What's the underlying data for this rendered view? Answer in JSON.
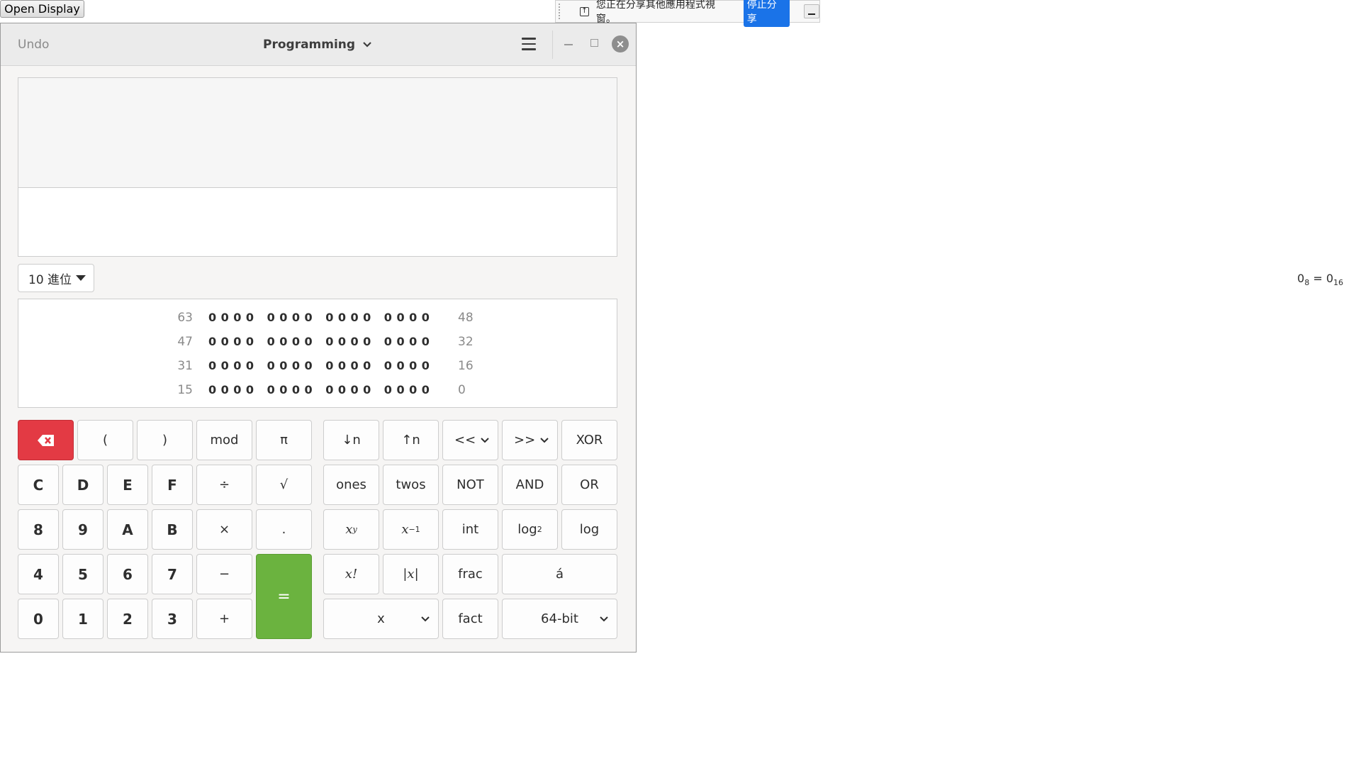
{
  "open_display": "Open Display",
  "share_bar": {
    "message": "您正在分享其他應用程式視窗。",
    "stop_label": "停止分享"
  },
  "header": {
    "undo": "Undo",
    "mode": "Programming"
  },
  "display": {
    "base_selector": "10 進位",
    "conversion_lhs": "0",
    "conversion_lhs_base": "8",
    "conversion_rhs": "0",
    "conversion_rhs_base": "16",
    "eq_sign": "="
  },
  "bits": [
    {
      "hi": "63",
      "value": "0000 0000 0000 0000",
      "lo": "48"
    },
    {
      "hi": "47",
      "value": "0000 0000 0000 0000",
      "lo": "32"
    },
    {
      "hi": "31",
      "value": "0000 0000 0000 0000",
      "lo": "16"
    },
    {
      "hi": "15",
      "value": "0000 0000 0000 0000",
      "lo": "0"
    }
  ],
  "keys": {
    "lparen": "(",
    "rparen": ")",
    "mod": "mod",
    "pi": "π",
    "c": "C",
    "d": "D",
    "e": "E",
    "f": "F",
    "divide": "÷",
    "sqrt": "√",
    "k8": "8",
    "k9": "9",
    "a": "A",
    "b": "B",
    "multiply": "×",
    "point": ".",
    "k4": "4",
    "k5": "5",
    "k6": "6",
    "k7": "7",
    "minus": "−",
    "equals": "=",
    "k0": "0",
    "k1": "1",
    "k2": "2",
    "k3": "3",
    "plus": "+",
    "shift_down": "↓n",
    "shift_up": "↑n",
    "lshift": "<<",
    "rshift": ">>",
    "xor": "XOR",
    "ones": "ones",
    "twos": "twos",
    "not": "NOT",
    "and": "AND",
    "or": "OR",
    "pow_x": "x",
    "pow_y": "y",
    "inv_x": "x",
    "inv_exp": "−1",
    "int": "int",
    "log2": "log",
    "log2_sub": "2",
    "log": "log",
    "fact_sym": "x!",
    "abs": "|x|",
    "frac": "frac",
    "accent": "á",
    "x_menu": "x",
    "fact": "fact",
    "word_size": "64-bit"
  }
}
